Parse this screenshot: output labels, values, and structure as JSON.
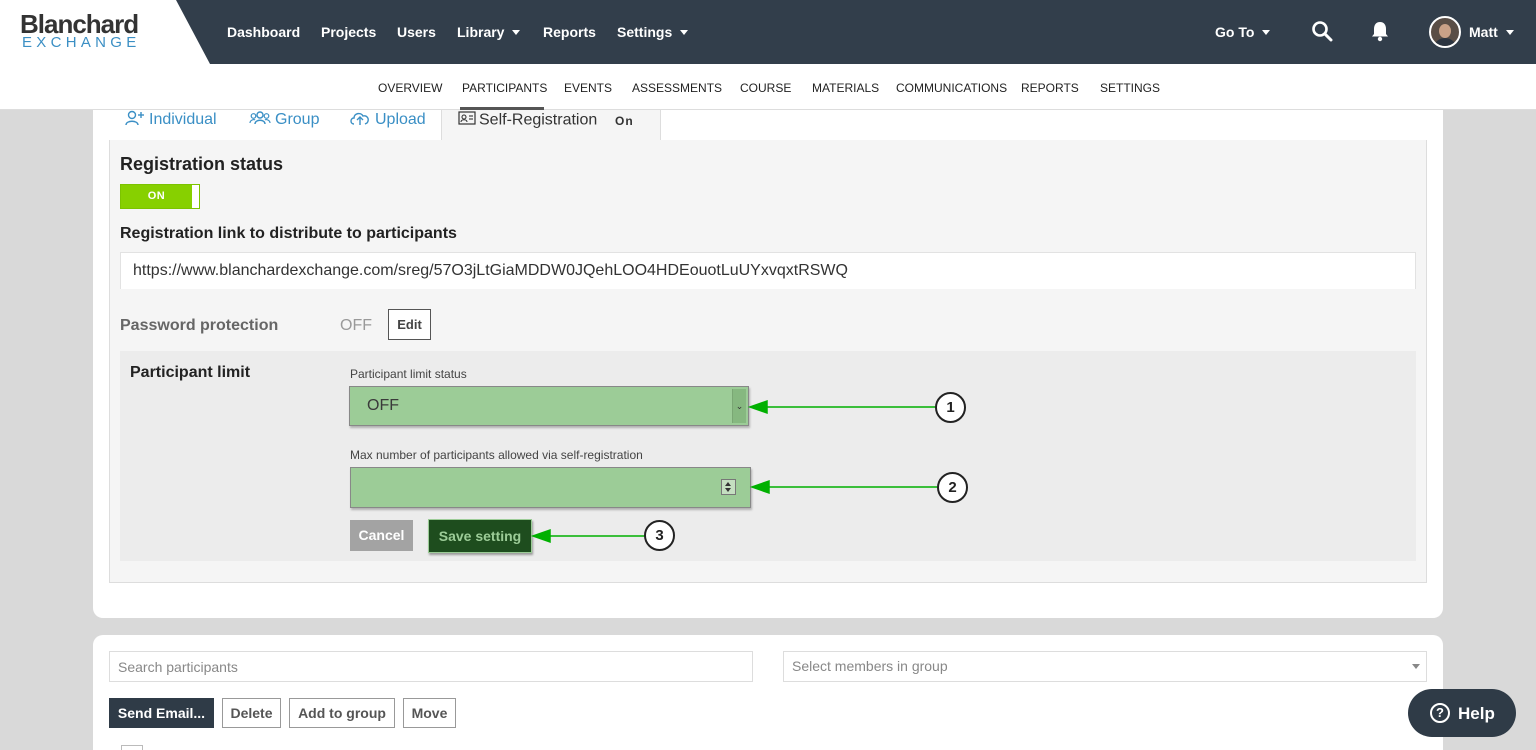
{
  "brand": {
    "name_top": "Blanchard",
    "name_bottom": "EXCHANGE"
  },
  "topnav": {
    "items": [
      {
        "label": "Dashboard"
      },
      {
        "label": "Projects"
      },
      {
        "label": "Users"
      },
      {
        "label": "Library"
      },
      {
        "label": "Reports"
      },
      {
        "label": "Settings"
      }
    ],
    "goto_label": "Go To",
    "user_name": "Matt"
  },
  "subnav": {
    "items": [
      "OVERVIEW",
      "PARTICIPANTS",
      "EVENTS",
      "ASSESSMENTS",
      "COURSE",
      "MATERIALS",
      "COMMUNICATIONS",
      "REPORTS",
      "SETTINGS"
    ],
    "active": "PARTICIPANTS"
  },
  "tabs": {
    "individual": "Individual",
    "group": "Group",
    "upload": "Upload",
    "self_registration": "Self-Registration",
    "self_registration_badge": "On"
  },
  "registration": {
    "status_title": "Registration status",
    "toggle_label": "ON",
    "link_title": "Registration link to distribute to participants",
    "link_url": "https://www.blanchardexchange.com/sreg/57O3jLtGiaMDDW0JQehLOO4HDEouotLuUYxvqxtRSWQ",
    "password_label": "Password protection",
    "password_status": "OFF",
    "edit_label": "Edit"
  },
  "participant_limit": {
    "title": "Participant limit",
    "status_label": "Participant limit status",
    "status_value": "OFF",
    "max_label": "Max number of participants allowed via self-registration",
    "max_value": "",
    "cancel_label": "Cancel",
    "save_label": "Save setting"
  },
  "participants_list": {
    "search_placeholder": "Search participants",
    "group_select_placeholder": "Select members in group",
    "actions": [
      "Send Email...",
      "Delete",
      "Add to group",
      "Move"
    ]
  },
  "help_label": "Help",
  "callouts": [
    "1",
    "2",
    "3"
  ],
  "colors": {
    "accent_green": "#87d000",
    "annotation_green": "#00b000",
    "nav_dark": "#323e4b",
    "link_blue": "#3a8fc5"
  }
}
